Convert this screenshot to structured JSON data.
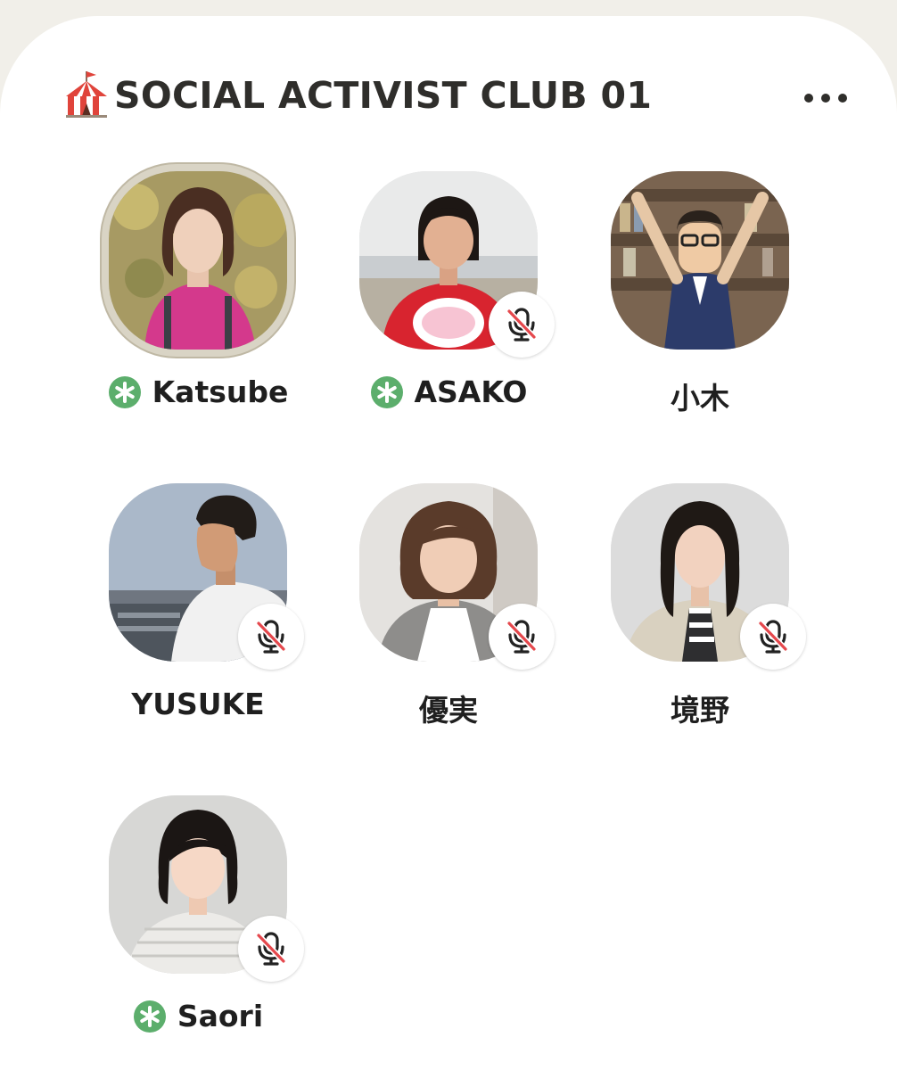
{
  "room": {
    "emoji": "circus-tent-emoji",
    "title": "SOCIAL ACTIVIST CLUB 01",
    "menu_icon": "more-horizontal-icon"
  },
  "colors": {
    "background": "#f1efe9",
    "card": "#ffffff",
    "moderator_green": "#5cae6c",
    "mute_red": "#e5484d",
    "speaking_ring": "#d9d4c5"
  },
  "speakers": [
    {
      "name": "Katsube",
      "moderator": true,
      "muted": false,
      "speaking": true
    },
    {
      "name": "ASAKO",
      "moderator": true,
      "muted": true,
      "speaking": false
    },
    {
      "name": "小木",
      "moderator": false,
      "muted": false,
      "speaking": false
    },
    {
      "name": "YUSUKE",
      "moderator": false,
      "muted": true,
      "speaking": false
    },
    {
      "name": "優実",
      "moderator": false,
      "muted": true,
      "speaking": false
    },
    {
      "name": "境野",
      "moderator": false,
      "muted": true,
      "speaking": false
    },
    {
      "name": "Saori",
      "moderator": true,
      "muted": true,
      "speaking": false
    }
  ]
}
